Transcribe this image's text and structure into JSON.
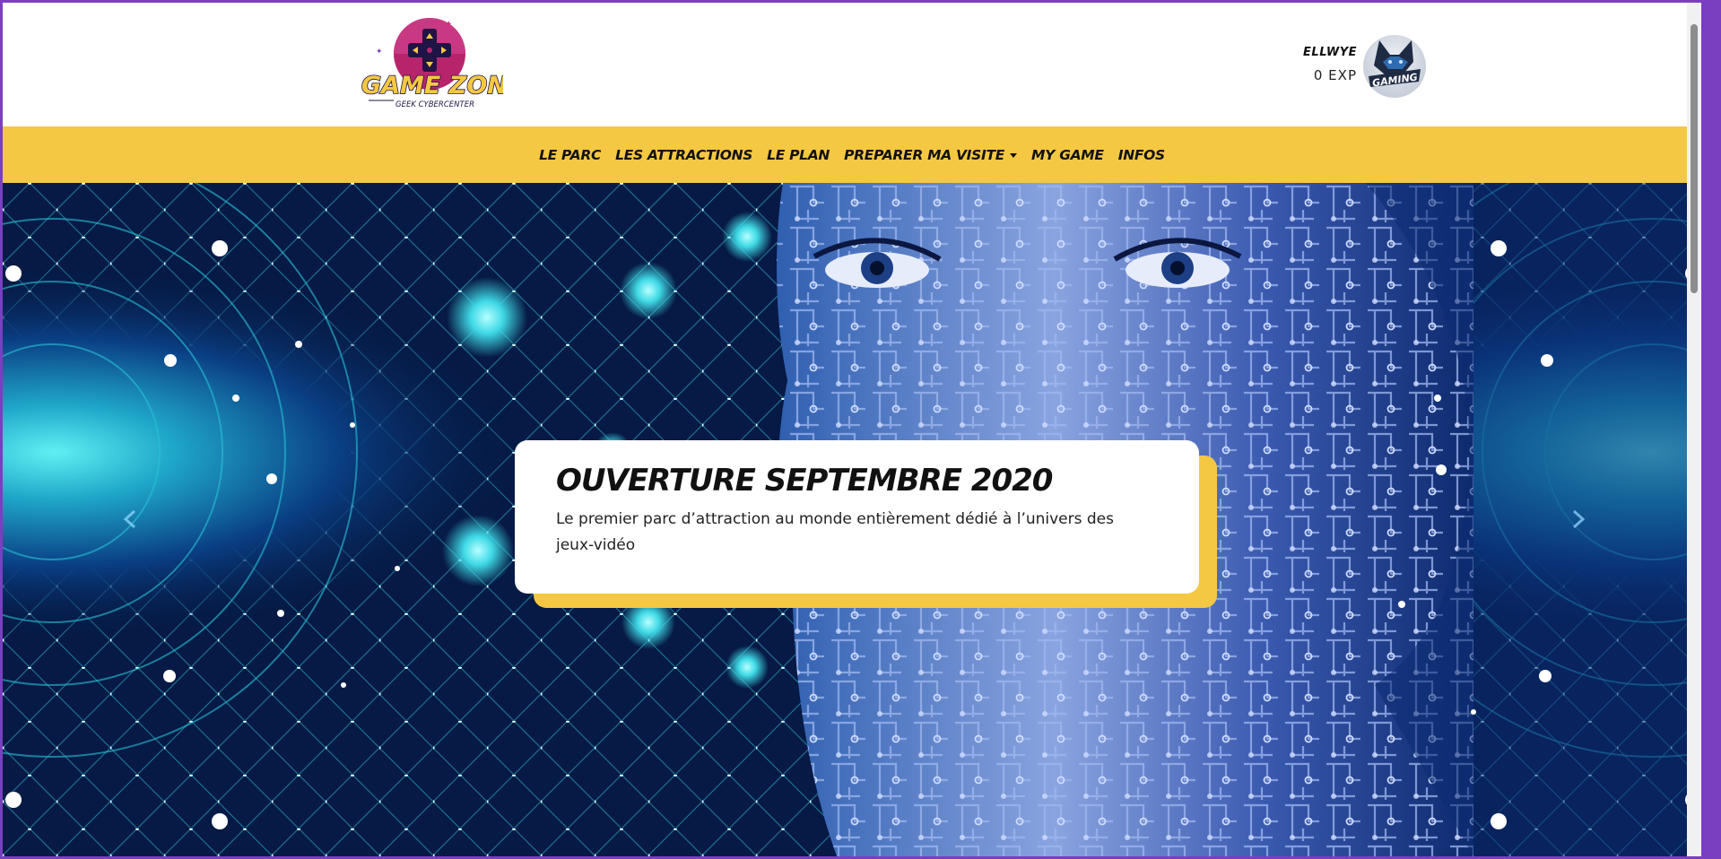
{
  "header": {
    "logo_text": "GAME ZONE",
    "logo_subtext": "GEEK CYBERCENTER",
    "user": {
      "name": "ELLWYE",
      "exp": "0 EXP",
      "avatar_text": "GAMING"
    }
  },
  "nav": {
    "items": [
      {
        "label": "LE PARC"
      },
      {
        "label": "LES ATTRACTIONS"
      },
      {
        "label": "LE PLAN"
      },
      {
        "label": "PREPARER MA VISITE",
        "dropdown": true
      },
      {
        "label": "MY GAME"
      },
      {
        "label": "INFOS"
      }
    ]
  },
  "hero": {
    "caption_title": "OUVERTURE SEPTEMBRE 2020",
    "caption_text": "Le premier parc d’attraction au monde entièrement dédié à l’univers des jeux-vidéo",
    "prev_icon": "chevron-left-icon",
    "next_icon": "chevron-right-icon"
  },
  "colors": {
    "accent": "#f5c843",
    "frame": "#7a3fc0",
    "hero_dark": "#061a45",
    "hero_cyan": "#38d6e8"
  }
}
